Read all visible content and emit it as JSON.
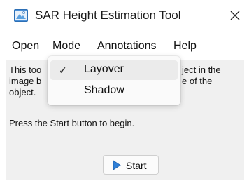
{
  "window": {
    "title": "SAR Height Estimation Tool",
    "close_glyph": "✕",
    "icon": "sar-app-icon"
  },
  "menubar": {
    "items": [
      "Open",
      "Mode",
      "Annotations",
      "Help"
    ]
  },
  "mode_menu": {
    "items": [
      {
        "label": "Layover",
        "checked": true,
        "check_glyph": "✓"
      },
      {
        "label": "Shadow",
        "checked": false
      }
    ]
  },
  "content": {
    "description_lines": [
      "This too",
      "image b",
      "object."
    ],
    "description_right_lines": [
      "ject in the",
      "e of the"
    ],
    "hint": "Press the Start button to begin."
  },
  "footer": {
    "start_label": "Start",
    "start_icon": "play-icon"
  },
  "colors": {
    "content_bg": "#f0f0f0",
    "hover_bg": "#ebebeb",
    "play_blue": "#2f7fd6"
  }
}
